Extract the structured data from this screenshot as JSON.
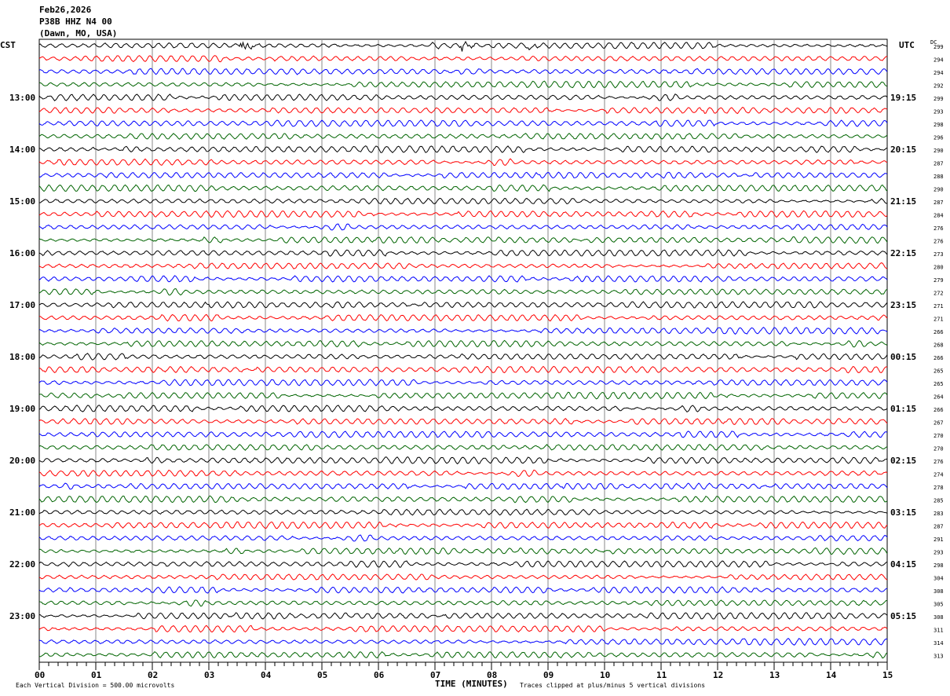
{
  "header": {
    "date": "Feb26,2026",
    "station": "P38B HHZ N4 00",
    "location": "(Dawn, MO, USA)"
  },
  "chart_data": {
    "type": "line",
    "subtype": "helicorder",
    "left_timezone": "CST",
    "right_timezone": "UTC",
    "dc_label": "DC",
    "xlabel": "TIME (MINUTES)",
    "x_ticks": [
      "00",
      "01",
      "02",
      "03",
      "04",
      "05",
      "06",
      "07",
      "08",
      "09",
      "10",
      "11",
      "12",
      "13",
      "14",
      "15"
    ],
    "xlim": [
      0,
      15
    ],
    "grid": true,
    "traces_per_hour": 4,
    "trace_colors": [
      "#000000",
      "#ff0000",
      "#0000ff",
      "#006400"
    ],
    "left_hour_labels": [
      "13:00",
      "14:00",
      "15:00",
      "16:00",
      "17:00",
      "18:00",
      "19:00",
      "20:00",
      "21:00",
      "22:00",
      "23:00"
    ],
    "right_hour_labels": [
      "19:15",
      "20:15",
      "21:15",
      "22:15",
      "23:15",
      "00:15",
      "01:15",
      "02:15",
      "03:15",
      "04:15",
      "05:15"
    ],
    "dc_offsets": [
      299,
      294,
      294,
      292,
      299,
      293,
      298,
      296,
      290,
      287,
      288,
      290,
      287,
      284,
      276,
      276,
      273,
      280,
      279,
      272,
      271,
      271,
      266,
      268,
      266,
      265,
      265,
      264,
      266,
      267,
      270,
      270,
      276,
      274,
      278,
      285,
      283,
      287,
      291,
      293,
      298,
      304,
      308,
      305,
      308,
      311,
      314,
      313
    ],
    "scale_note": "Each Vertical Division =  500.00 microvolts",
    "clip_note": "Traces clipped at plus/minus 5 vertical divisions"
  }
}
